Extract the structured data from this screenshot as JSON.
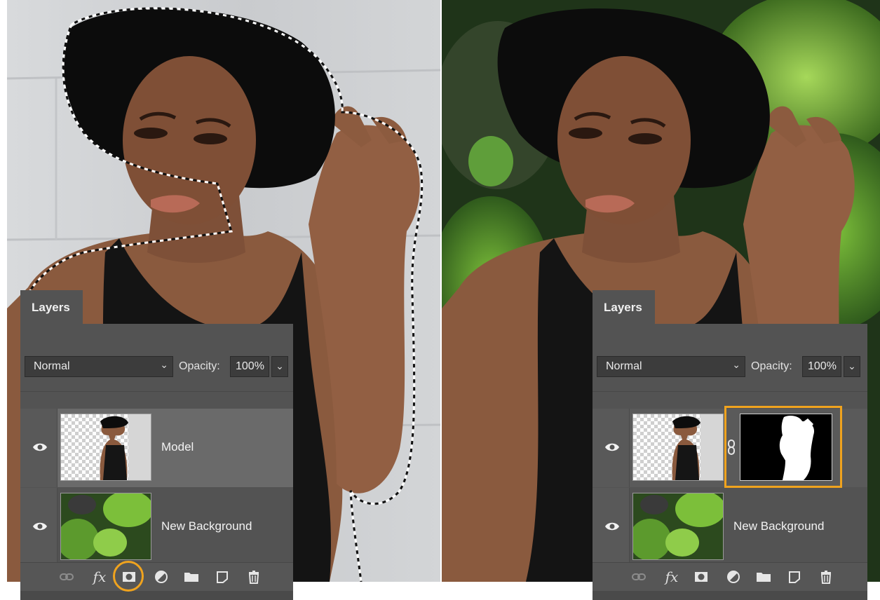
{
  "left_panel": {
    "tab_label": "Layers",
    "blend_mode": "Normal",
    "opacity_label": "Opacity:",
    "opacity_value": "100%",
    "layers": [
      {
        "name": "Model",
        "selected": true,
        "visible": true,
        "has_mask": false
      },
      {
        "name": "New Background",
        "selected": false,
        "visible": true,
        "has_mask": false
      }
    ],
    "toolbar": {
      "link_icon": "link-icon",
      "fx_label": "fx",
      "mask_icon": "add-mask-icon",
      "adjustment_icon": "adjustment-layer-icon",
      "folder_icon": "new-group-icon",
      "new_layer_icon": "new-layer-icon",
      "trash_icon": "delete-layer-icon",
      "highlighted": "add-mask-icon"
    }
  },
  "right_panel": {
    "tab_label": "Layers",
    "blend_mode": "Normal",
    "opacity_label": "Opacity:",
    "opacity_value": "100%",
    "layers": [
      {
        "name": "",
        "selected": false,
        "visible": true,
        "has_mask": true
      },
      {
        "name": "New Background",
        "selected": false,
        "visible": true,
        "has_mask": false
      }
    ],
    "toolbar": {
      "fx_label": "fx",
      "highlighted": "layer-mask-thumbnail"
    }
  },
  "colors": {
    "panel_bg": "#535353",
    "highlight": "#f0a31e",
    "foliage": "#4f7a2a",
    "wall": "#cfd1d3"
  }
}
